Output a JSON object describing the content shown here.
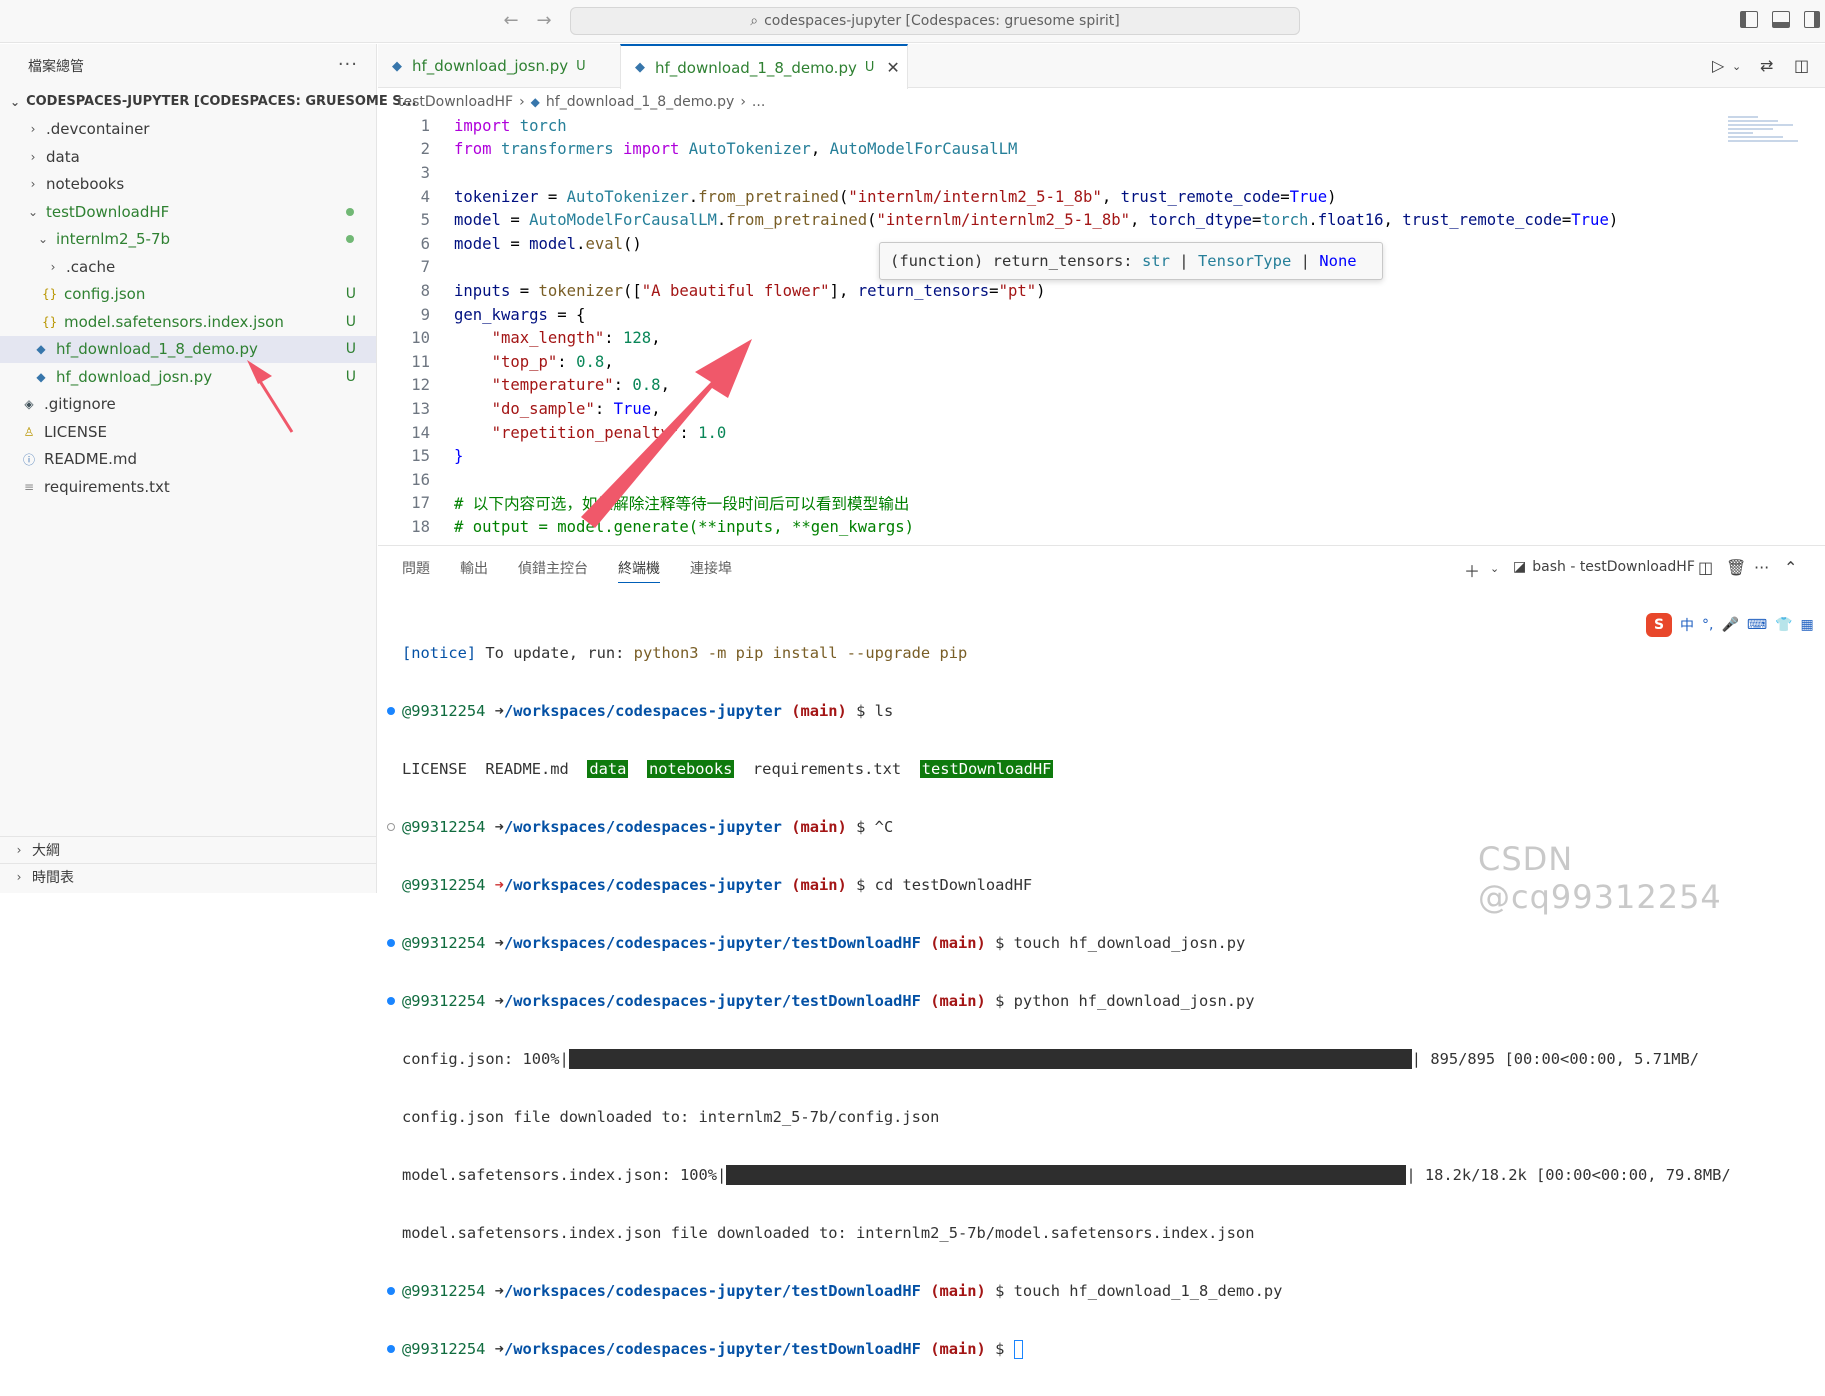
{
  "titlebar": {
    "command_center": "codespaces-jupyter [Codespaces: gruesome spirit]"
  },
  "sidebar": {
    "title": "檔案總管",
    "more": "···",
    "root": "CODESPACES-JUPYTER [CODESPACES: GRUESOME S...",
    "items": [
      {
        "label": ".devcontainer"
      },
      {
        "label": "data"
      },
      {
        "label": "notebooks"
      },
      {
        "label": "testDownloadHF"
      },
      {
        "label": "internlm2_5-7b"
      },
      {
        "label": ".cache"
      },
      {
        "label": "config.json",
        "badge": "U"
      },
      {
        "label": "model.safetensors.index.json",
        "badge": "U"
      },
      {
        "label": "hf_download_1_8_demo.py",
        "badge": "U"
      },
      {
        "label": "hf_download_josn.py",
        "badge": "U"
      },
      {
        "label": ".gitignore"
      },
      {
        "label": "LICENSE"
      },
      {
        "label": "README.md"
      },
      {
        "label": "requirements.txt"
      }
    ],
    "outline": "大綱",
    "timeline": "時間表"
  },
  "tabs": [
    {
      "label": "hf_download_josn.py",
      "badge": "U"
    },
    {
      "label": "hf_download_1_8_demo.py",
      "badge": "U",
      "close": "✕"
    }
  ],
  "breadcrumb": {
    "folder": "testDownloadHF",
    "file": "hf_download_1_8_demo.py",
    "rest": "..."
  },
  "code": {
    "ln": [
      "1",
      "2",
      "3",
      "4",
      "5",
      "6",
      "7",
      "8",
      "9",
      "10",
      "11",
      "12",
      "13",
      "14",
      "15",
      "16",
      "17",
      "18"
    ],
    "l1a": "import",
    "l1b": "torch",
    "l2a": "from",
    "l2b": "transformers",
    "l2c": "import",
    "l2d": "AutoTokenizer",
    "l2e": "AutoModelForCausalLM",
    "l4a": "tokenizer",
    "l4b": "AutoTokenizer",
    "l4c": "from_pretrained",
    "l4d": "\"internlm/internlm2_5-1_8b\"",
    "l4e": "trust_remote_code",
    "l4f": "True",
    "l5a": "model",
    "l5b": "AutoModelForCausalLM",
    "l5c": "from_pretrained",
    "l5d": "\"internlm/internlm2_5-1_8b\"",
    "l5e": "torch_dtype",
    "l5f": "torch",
    "l5g": "float16",
    "l5h": "trust_remote_code",
    "l5i": "True",
    "l6a": "model",
    "l6b": "model",
    "l6c": "eval",
    "l8a": "inputs",
    "l8b": "tokenizer",
    "l8c": "\"A beautiful flower\"",
    "l8d": "return_tensors",
    "l8e": "\"pt\"",
    "l9a": "gen_kwargs",
    "l10a": "\"max_length\"",
    "l10b": "128",
    "l11a": "\"top_p\"",
    "l11b": "0.8",
    "l12a": "\"temperature\"",
    "l12b": "0.8",
    "l13a": "\"do_sample\"",
    "l13b": "True",
    "l14a": "\"repetition_penalty\"",
    "l14b": "1.0",
    "l17": "# 以下内容可选，如果解除注释等待一段时间后可以看到模型输出",
    "l18": "# output = model.generate(**inputs, **gen_kwargs)"
  },
  "hover": {
    "a": "(function) return_tensors: ",
    "b": "str",
    "c": " | ",
    "d": "TensorType",
    "e": " | ",
    "f": "None"
  },
  "panel": {
    "tabs": [
      "問題",
      "輸出",
      "偵錯主控台",
      "終端機",
      "連接埠"
    ],
    "terminal_name": "bash - testDownloadHF"
  },
  "terminal": {
    "l1a": "[notice]",
    "l1b": " To update, run: ",
    "l1c": "python3 -m pip install --upgrade pip",
    "user": "@99312254",
    "root_path": "/workspaces/codespaces-jupyter",
    "sub_path": "/workspaces/codespaces-jupyter/testDownloadHF",
    "branch": "(main)",
    "c1": "ls",
    "ls_plain1": "LICENSE  README.md  ",
    "ls_data": "data",
    "ls_nb": "notebooks",
    "ls_plain2": "requirements.txt  ",
    "ls_hf": "testDownloadHF",
    "c2": "^C",
    "c3": "cd testDownloadHF",
    "c4": "touch hf_download_josn.py",
    "c5": "python hf_download_josn.py",
    "p1a": "config.json: 100%|",
    "p1b": "| 895/895 [00:00<00:00, 5.71MB/",
    "p1_progress": 1.0,
    "d1": "config.json file downloaded to: internlm2_5-7b/config.json",
    "p2a": "model.safetensors.index.json: 100%|",
    "p2b": "| 18.2k/18.2k [00:00<00:00, 79.8MB/",
    "p2_progress": 1.0,
    "d2": "model.safetensors.index.json file downloaded to: internlm2_5-7b/model.safetensors.index.json",
    "c6": "touch hf_download_1_8_demo.py",
    "dollar": "$"
  },
  "ime": {
    "lang": "中"
  },
  "watermark": "CSDN @cq99312254",
  "colors": {
    "accent": "#005fb8",
    "git_untracked": "#2f8132",
    "arrow": "#f0586a"
  }
}
